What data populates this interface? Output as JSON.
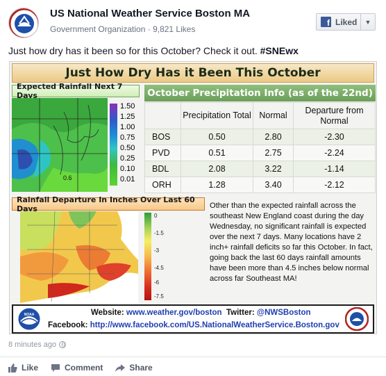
{
  "post": {
    "page_name": "US National Weather Service Boston MA",
    "page_meta": "Government Organization · 9,821 Likes",
    "liked_label": "Liked",
    "text": "Just how dry has it been so for this October? Check it out. ",
    "hashtag": "#SNEwx",
    "timestamp": "8 minutes ago",
    "actions": {
      "like": "Like",
      "comment": "Comment",
      "share": "Share"
    }
  },
  "infographic": {
    "title": "Just How Dry Has it Been This October",
    "rain7_label": "Expected Rainfall Next 7 Days",
    "rain7_legend": [
      "1.50",
      "1.25",
      "1.00",
      "0.75",
      "0.50",
      "0.25",
      "0.10",
      "0.01"
    ],
    "map7_point": "0.6",
    "table_title": "October Precipitation Info (as of the 22nd)",
    "table_headers": [
      "",
      "Precipitation Total",
      "Normal",
      "Departure from Normal"
    ],
    "table_rows": [
      {
        "site": "BOS",
        "total": "0.50",
        "normal": "2.80",
        "departure": "-2.30"
      },
      {
        "site": "PVD",
        "total": "0.51",
        "normal": "2.75",
        "departure": "-2.24"
      },
      {
        "site": "BDL",
        "total": "2.08",
        "normal": "3.22",
        "departure": "-1.14"
      },
      {
        "site": "ORH",
        "total": "1.28",
        "normal": "3.40",
        "departure": "-2.12"
      }
    ],
    "rain60_label": "Rainfall Departure In Inches Over Last 60 Days",
    "rain60_legend": [
      "0",
      "-1.5",
      "-3",
      "-4.5",
      "-6",
      "-7.5"
    ],
    "description": "Other than the expected rainfall across the southeast New England coast during the day Wednesday, no significant rainfall is expected over the next 7 days.  Many locations have 2 inch+ rainfall deficits so far this October.   In fact, going back the last 60 days rainfall amounts have been more than 4.5 inches below normal across far Southeast MA!",
    "website_label": "Website:",
    "website_url": "www.weather.gov/boston",
    "twitter_label": "Twitter:",
    "twitter_handle": "@NWSBoston",
    "facebook_label": "Facebook:",
    "facebook_url": "http://www.facebook.com/US.NationalWeatherService.Boston.gov",
    "noaa_logo_text": "NOAA"
  },
  "colors": {
    "facebook_blue": "#3b5998",
    "link_blue": "#1f3fb0",
    "table_header_green": "#6b9e5a",
    "title_tan": "#ecc985"
  }
}
